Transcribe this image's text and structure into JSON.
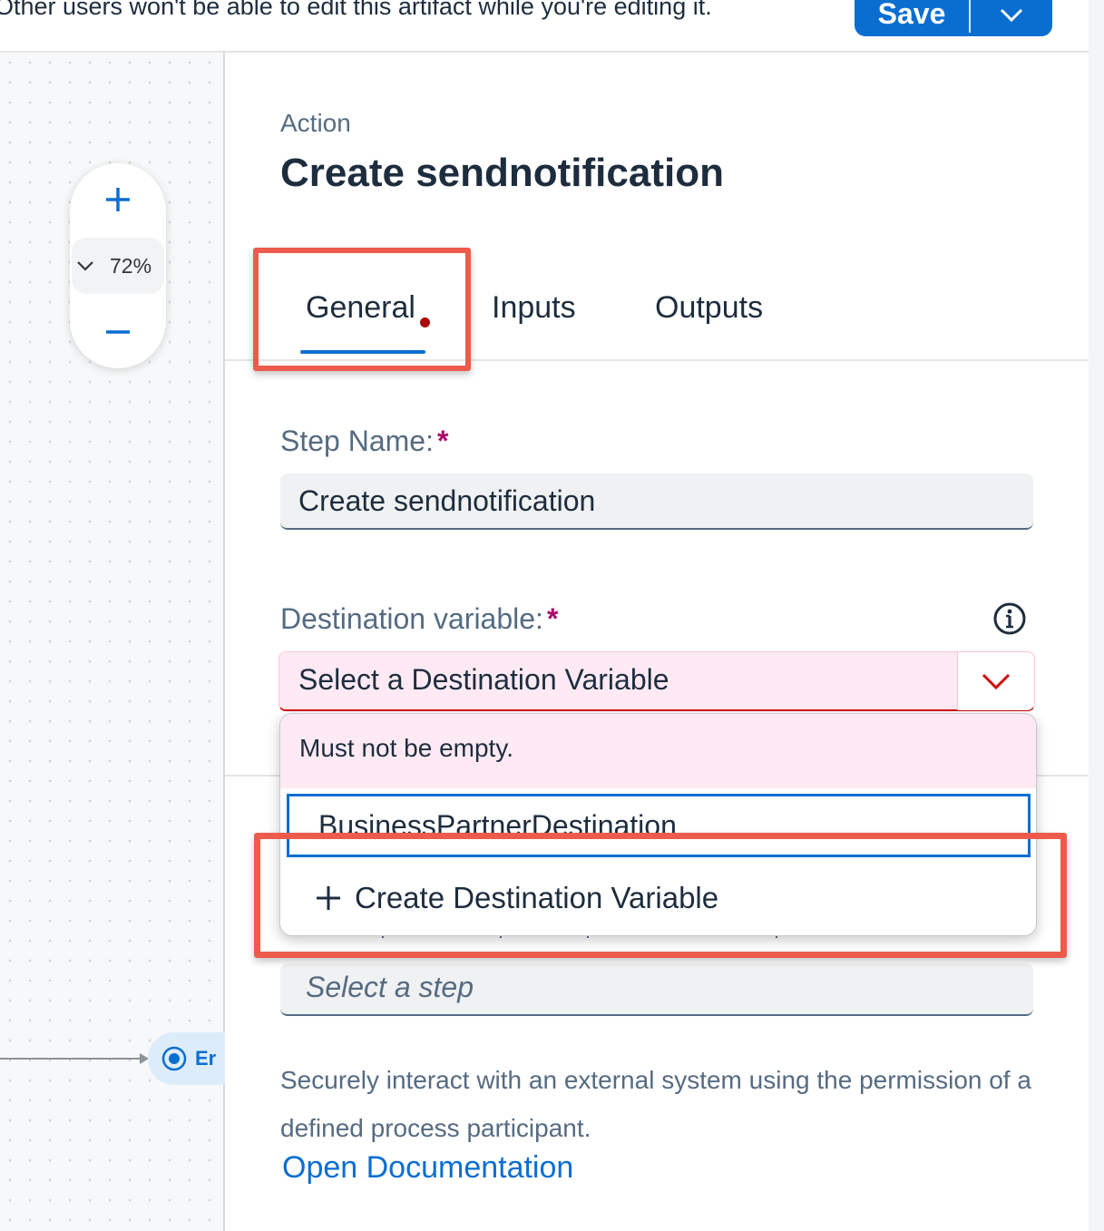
{
  "header": {
    "lock_message": "Other users won't be able to edit this artifact while you're editing it.",
    "save_label": "Save"
  },
  "canvas": {
    "zoom_level": "72%",
    "end_node_label": "Er"
  },
  "panel": {
    "subtitle": "Action",
    "title": "Create sendnotification",
    "tabs": [
      {
        "label": "General",
        "active": true,
        "has_error_dot": true
      },
      {
        "label": "Inputs",
        "active": false
      },
      {
        "label": "Outputs",
        "active": false
      }
    ],
    "step_name": {
      "label": "Step Name:",
      "required_marker": "*",
      "value": "Create sendnotification"
    },
    "destination_variable": {
      "label": "Destination variable:",
      "required_marker": "*",
      "placeholder": "Select a Destination Variable"
    },
    "step_select": {
      "placeholder": "Select a step"
    },
    "description": "Securely interact with an external system using the permission of a defined process participant.",
    "doc_link": "Open Documentation"
  },
  "dropdown": {
    "validation_message": "Must not be empty.",
    "items": [
      {
        "label": "BusinessPartnerDestination",
        "focused": true
      }
    ],
    "create_label": "Create Destination Variable"
  },
  "colors": {
    "accent": "#0a6ed1",
    "highlight": "#ec5b4c",
    "error_bg": "#ffeaf4",
    "error": "#d20a0a"
  },
  "icons": [
    "chevron-down-icon",
    "plus-icon",
    "minus-icon",
    "info-icon",
    "end-event-icon"
  ]
}
